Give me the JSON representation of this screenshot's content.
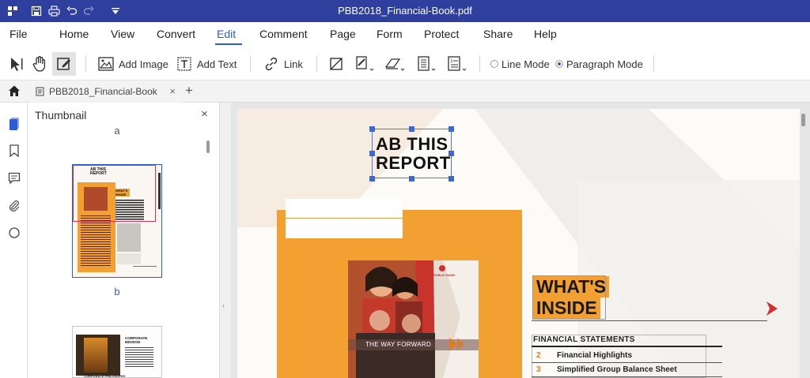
{
  "app": {
    "window_title": "PBB2018_Financial-Book.pdf"
  },
  "menu": {
    "items": [
      "File",
      "Home",
      "View",
      "Convert",
      "Edit",
      "Comment",
      "Page",
      "Form",
      "Protect",
      "Share",
      "Help"
    ],
    "active": "Edit"
  },
  "toolbar": {
    "add_image": "Add Image",
    "add_text": "Add Text",
    "link": "Link",
    "line_mode": "Line Mode",
    "paragraph_mode": "Paragraph Mode",
    "selected_mode": "Paragraph Mode"
  },
  "tabs": {
    "doc_tab_label": "PBB2018_Financial-Book"
  },
  "thumbnail_panel": {
    "title": "Thumbnail",
    "page_labels": [
      "a",
      "b"
    ]
  },
  "thumb_page_a": {
    "title_lines": [
      "AB THIS",
      "REPORT"
    ],
    "whats": "WHAT'S INSIDE"
  },
  "thumb_page_b": {
    "heading": "CORPORATE MISSION",
    "sub": "CORPORATE PHILOSOPHY"
  },
  "document": {
    "headline_line1": "AB THIS",
    "headline_line2": "REPORT",
    "cover_caption": "THE WAY FORWARD",
    "cover_brand": "PUBLIC BANK",
    "whats_inside_line1": "WHAT'S",
    "whats_inside_line2": "INSIDE",
    "section_title": "FINANCIAL STATEMENTS",
    "rows": [
      {
        "num": "2",
        "label": "Financial Highlights"
      },
      {
        "num": "3",
        "label": "Simplified Group Balance Sheet"
      }
    ]
  },
  "colors": {
    "titlebar": "#2e3f9e",
    "accent": "#2e5bd8",
    "brand_orange": "#f3a033",
    "brand_red": "#d32f2f"
  }
}
